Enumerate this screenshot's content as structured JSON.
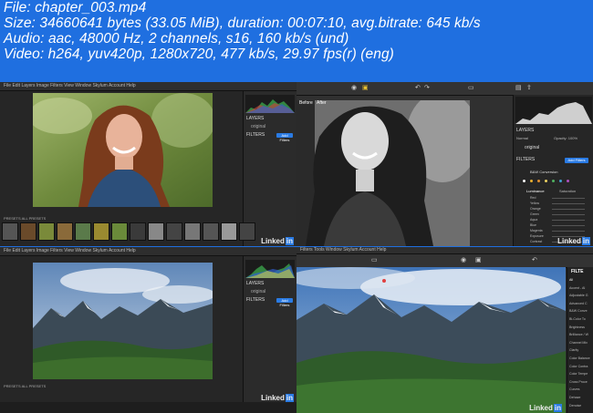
{
  "header": {
    "line1": "File: chapter_003.mp4",
    "line2": "Size: 34660641 bytes (33.05 MiB), duration: 00:07:10, avg.bitrate: 645 kb/s",
    "line3": "Audio: aac, 48000 Hz, 2 channels, s16, 160 kb/s (und)",
    "line4": "Video: h264, yuv420p, 1280x720, 477 kb/s, 29.97 fps(r) (eng)"
  },
  "frame1": {
    "menu": "File  Edit  Layers  Image  Filters  View  Window  Skylum Account  Help",
    "panel_label": "LAYERS",
    "panel_row": "original",
    "filters_label": "FILTERS",
    "add_button": "Add Filters",
    "strip_label": "PRESETS  ALL PRESETS",
    "watermark": "Linked",
    "watermark_in": "in"
  },
  "frame2": {
    "before_label": "Before",
    "after_label": "After",
    "layers_label": "LAYERS",
    "normal_label": "Normal",
    "opacity_label": "Opacity: 100%",
    "layer_name": "original",
    "filters_label": "FILTERS",
    "add_filters": "Add Filters",
    "filter_name": "B&W Conversion",
    "tab_luminance": "Luminance",
    "tab_saturation": "Saturation",
    "rows": [
      "Red",
      "Yellow",
      "Orange",
      "Green",
      "Aqua",
      "Blue",
      "Magenta",
      "Exposure",
      "Contrast"
    ],
    "watermark": "Linked",
    "watermark_in": "in"
  },
  "frame3": {
    "menu": "File  Edit  Layers  Image  Filters  View  Window  Skylum Account  Help",
    "panel_label": "LAYERS",
    "panel_row": "original",
    "filters_label": "FILTERS",
    "add_button": "Add Filters",
    "strip_label": "PRESETS  ALL PRESETS",
    "watermark": "Linked",
    "watermark_in": "in"
  },
  "frame4": {
    "menu": "Filters  Tools  Window  Skylum Account  Help",
    "filters_title": "FILTE",
    "filter_list": [
      "All",
      "Accent - AI",
      "Adjustable G",
      "Advanced C",
      "B&W Conve",
      "Bi-Color To",
      "Brightness",
      "Brilliance / W",
      "Channel Mix",
      "Clarity",
      "Color Balance",
      "Color Contra",
      "Color Tempe",
      "Cross Proce",
      "Curves",
      "Dehaze",
      "Denoise"
    ],
    "watermark": "Linked",
    "watermark_in": "in"
  },
  "colors": {
    "background": "#1f6fe0",
    "app_dark": "#262626",
    "accent_blue": "#2a7be4"
  }
}
